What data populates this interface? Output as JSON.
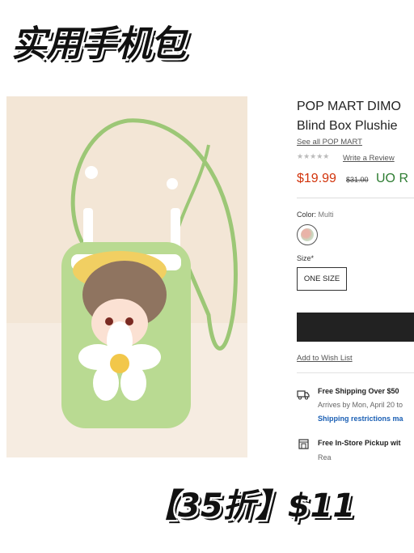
{
  "banner": {
    "top_title": "实用手机包",
    "bottom_text": "【35折】$11"
  },
  "product": {
    "title_line1": "POP MART DIMO",
    "title_line2": "Blind Box Plushie",
    "brand_link": "See all POP MART",
    "rating_stars": "★★★★★",
    "review_link": "Write a Review",
    "price": "$19.99",
    "original_price": "$31.00",
    "uo_price": "UO R",
    "color_label": "Color:",
    "color_value": "Multi",
    "size_label": "Size*",
    "size_option": "ONE SIZE",
    "add_to_cart": "",
    "wish_link": "Add to Wish List",
    "shipping_title": "Free Shipping Over $50",
    "shipping_eta": "Arrives by Mon, April 20 to",
    "shipping_restrictions": "Shipping restrictions ma",
    "pickup_title": "Free In-Store Pickup wit",
    "pickup_sub": "Rea"
  },
  "colors": {
    "price": "#d2340c",
    "uo": "#2e7d32",
    "link_blue": "#1a5fb4",
    "button": "#222222"
  }
}
